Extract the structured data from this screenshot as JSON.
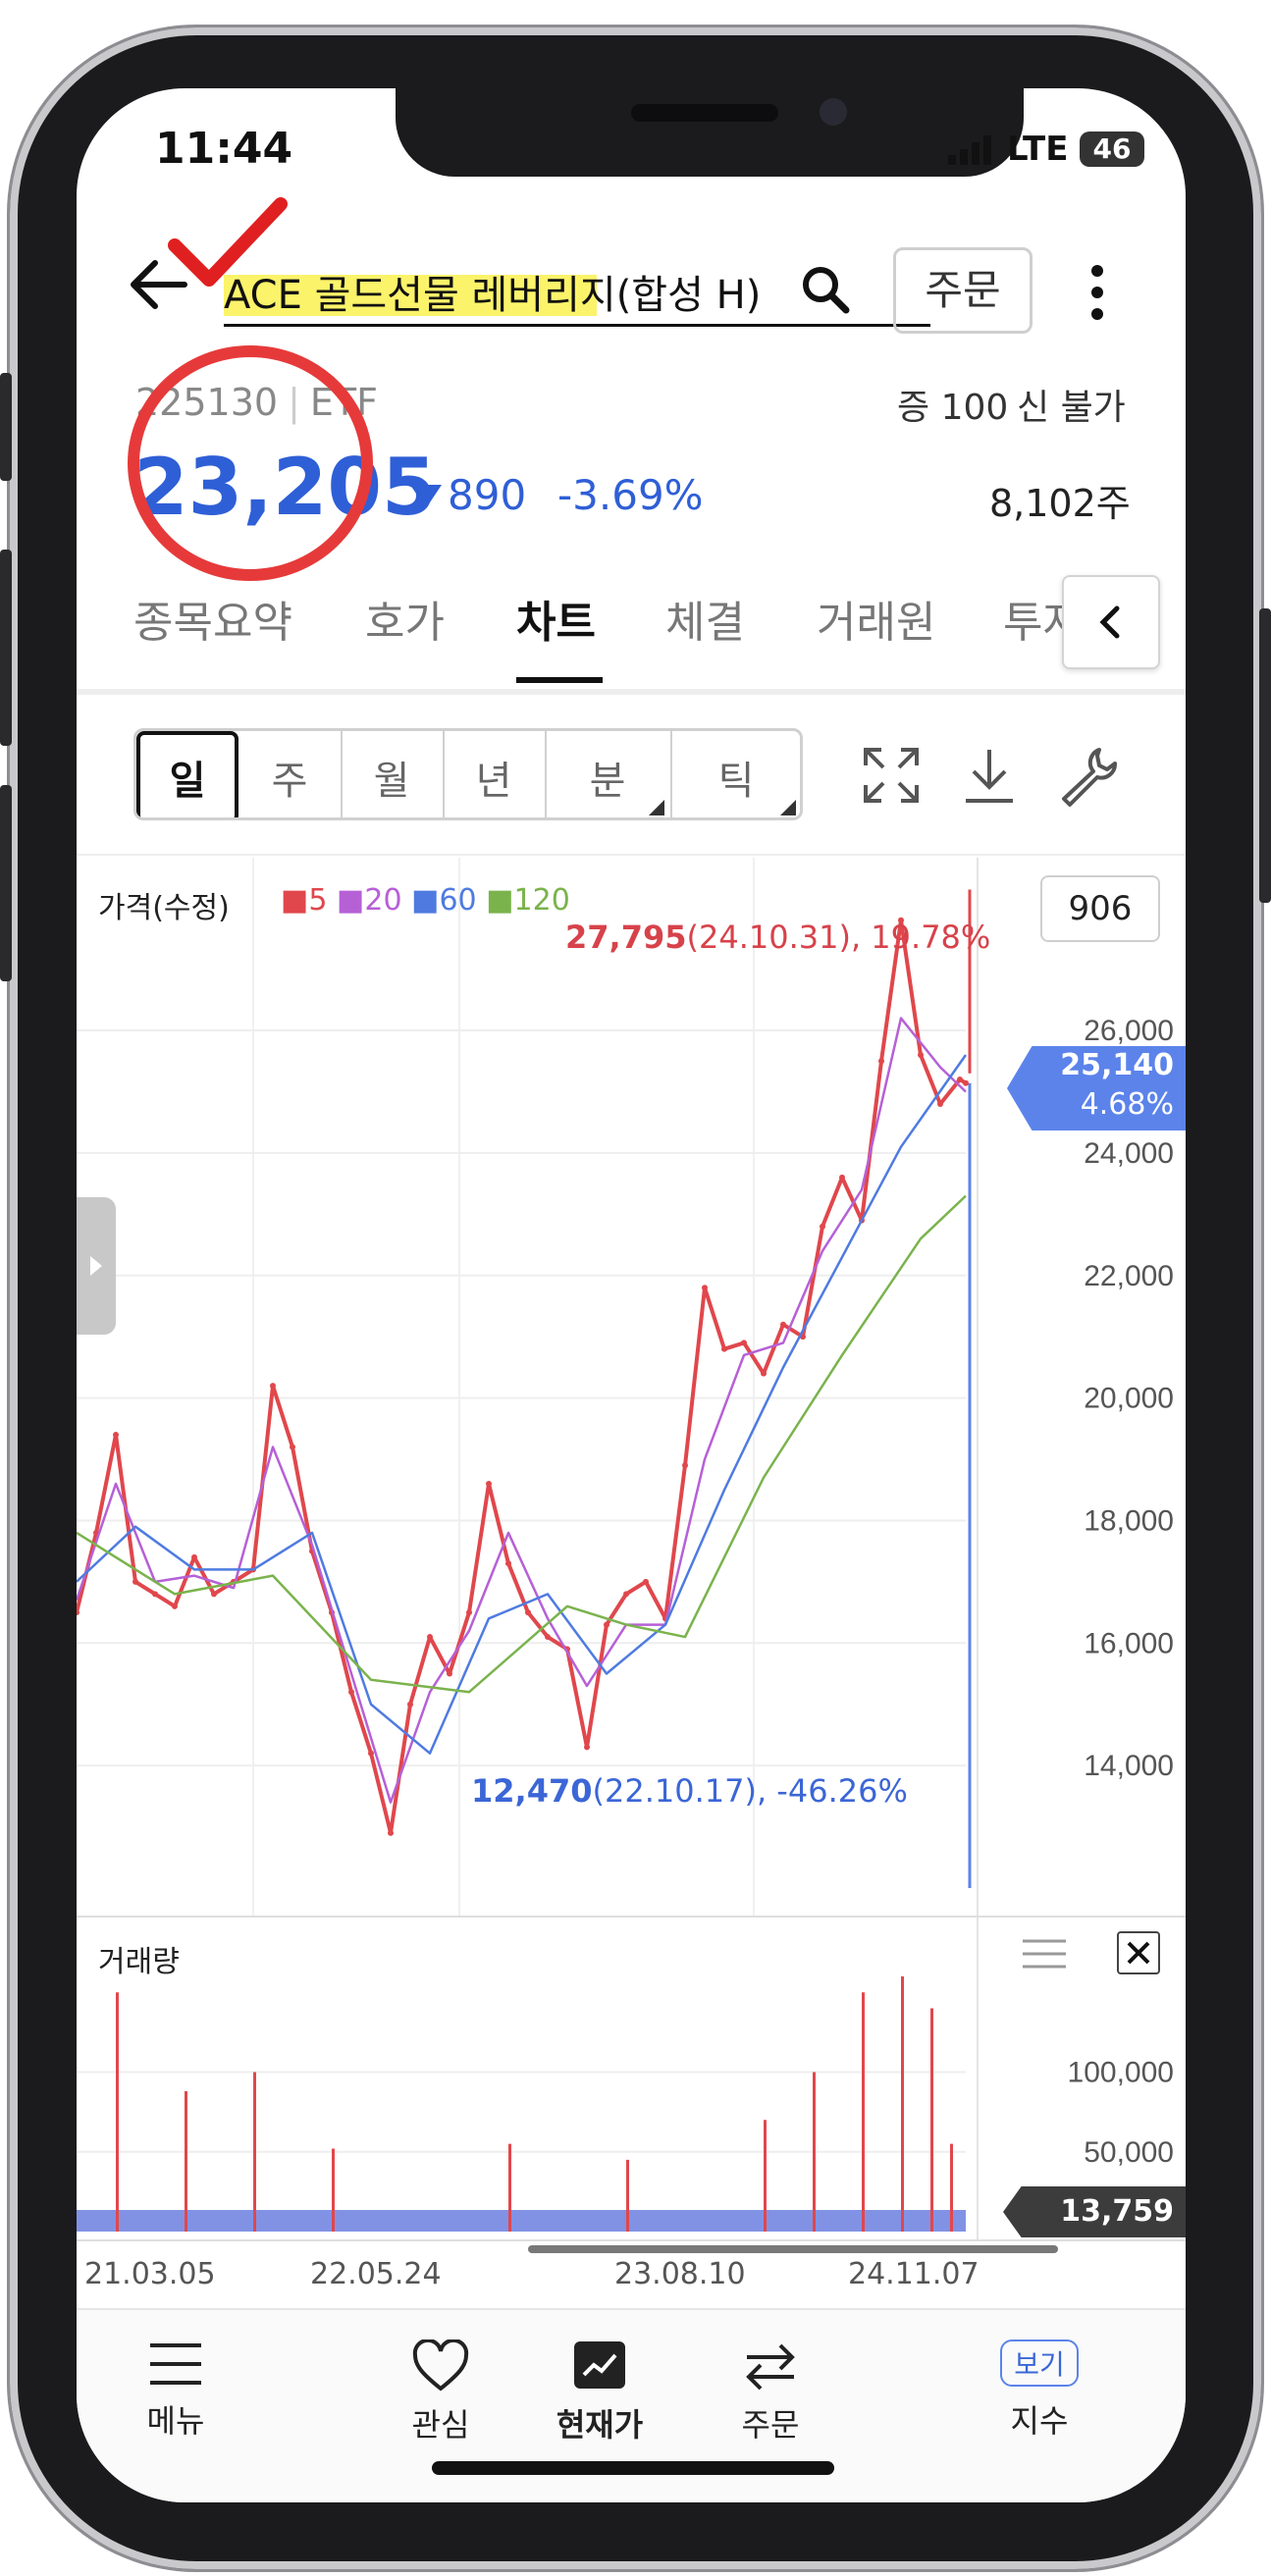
{
  "status_bar": {
    "time": "11:44",
    "network": "LTE",
    "battery": "46"
  },
  "header": {
    "title": "ACE 골드선물 레버리지(합성 H)",
    "order_button": "주문"
  },
  "stock": {
    "code": "225130",
    "type": "ETF",
    "margin": "증 100",
    "credit": "신 불가",
    "price": "23,205",
    "change": "890",
    "change_pct": "-3.69%",
    "volume": "8,102주"
  },
  "tabs": [
    "종목요약",
    "호가",
    "차트",
    "체결",
    "거래원",
    "투자"
  ],
  "active_tab": "차트",
  "period_buttons": [
    "일",
    "주",
    "월",
    "년",
    "분",
    "틱"
  ],
  "active_period": "일",
  "chart_panel": {
    "price_label": "가격(수정)",
    "ma_legend": [
      {
        "label": "5",
        "color": "#e0474c"
      },
      {
        "label": "20",
        "color": "#b660d6"
      },
      {
        "label": "60",
        "color": "#4f7be0"
      },
      {
        "label": "120",
        "color": "#7ab34c"
      }
    ],
    "count_box": "906",
    "high_annotation": {
      "value": "27,795",
      "detail": "(24.10.31), 19.78%"
    },
    "low_annotation": {
      "value": "12,470",
      "detail": "(22.10.17), -46.26%"
    },
    "current_price": "25,140",
    "current_pct": "4.68%",
    "volume_label": "거래량",
    "current_volume": "13,759",
    "x_ticks": [
      "21.03.05",
      "22.05.24",
      "23.08.10",
      "24.11.07"
    ]
  },
  "chart_data": [
    {
      "type": "line",
      "title": "가격(수정)",
      "y_ticks": [
        "26,000",
        "24,000",
        "22,000",
        "20,000",
        "18,000",
        "16,000",
        "14,000"
      ],
      "ylim": [
        12000,
        28500
      ],
      "series": [
        {
          "name": "5",
          "color": "#e0474c",
          "x": [
            0,
            20,
            40,
            60,
            80,
            100,
            120,
            140,
            160,
            180,
            200,
            220,
            240,
            260,
            280,
            300,
            320,
            340,
            360,
            380,
            400,
            420,
            440,
            460,
            480,
            500,
            520,
            540,
            560,
            580,
            600,
            620,
            640,
            660,
            680,
            700,
            720,
            740,
            760,
            780,
            800,
            820,
            840,
            860,
            880,
            900,
            906
          ],
          "values": [
            16500,
            17800,
            19400,
            17000,
            16800,
            16600,
            17400,
            16800,
            17000,
            17200,
            20200,
            19200,
            17500,
            16500,
            15200,
            14200,
            12900,
            15000,
            16100,
            15500,
            16500,
            18600,
            17300,
            16500,
            16100,
            15900,
            14300,
            16300,
            16800,
            17000,
            16400,
            18900,
            21800,
            20800,
            20900,
            20400,
            21200,
            21000,
            22800,
            23600,
            22900,
            25500,
            27800,
            25600,
            24800,
            25200,
            25140
          ]
        },
        {
          "name": "20",
          "color": "#b660d6",
          "x": [
            0,
            40,
            80,
            120,
            160,
            200,
            240,
            280,
            320,
            360,
            400,
            440,
            480,
            520,
            560,
            600,
            640,
            680,
            720,
            760,
            800,
            840,
            880,
            906
          ],
          "values": [
            16700,
            18600,
            17000,
            17100,
            16900,
            19200,
            17600,
            15500,
            13400,
            15200,
            16200,
            17800,
            16400,
            15300,
            16300,
            16300,
            19000,
            20700,
            20900,
            22400,
            23400,
            26200,
            25400,
            25000
          ]
        },
        {
          "name": "60",
          "color": "#4f7be0",
          "x": [
            0,
            60,
            120,
            180,
            240,
            300,
            360,
            420,
            480,
            540,
            600,
            660,
            720,
            780,
            840,
            906
          ],
          "values": [
            17000,
            17900,
            17200,
            17200,
            17800,
            15000,
            14200,
            16400,
            16800,
            15500,
            16300,
            18500,
            20500,
            22300,
            24100,
            25600
          ]
        },
        {
          "name": "120",
          "color": "#7ab34c",
          "x": [
            0,
            100,
            200,
            300,
            400,
            500,
            560,
            620,
            700,
            780,
            860,
            906
          ],
          "values": [
            17800,
            16800,
            17100,
            15400,
            15200,
            16600,
            16300,
            16100,
            18700,
            20700,
            22600,
            23300
          ]
        }
      ]
    },
    {
      "type": "bar",
      "title": "거래량",
      "y_ticks": [
        "100,000",
        "50,000"
      ],
      "ylim": [
        0,
        160000
      ],
      "series": [
        {
          "name": "거래량",
          "color": "#e0474c",
          "x": [
            40,
            110,
            180,
            260,
            440,
            560,
            700,
            750,
            800,
            840,
            870,
            890
          ],
          "values": [
            150000,
            88000,
            100000,
            52000,
            55000,
            45000,
            70000,
            100000,
            150000,
            160000,
            140000,
            55000
          ]
        }
      ]
    }
  ],
  "bottom_nav": [
    {
      "label": "메뉴",
      "icon": "hamburger-icon"
    },
    {
      "label": "관심",
      "icon": "heart-icon"
    },
    {
      "label": "현재가",
      "icon": "chart-icon"
    },
    {
      "label": "주문",
      "icon": "swap-icon"
    },
    {
      "label": "지수",
      "icon": "index-icon",
      "badge": "보기"
    }
  ]
}
